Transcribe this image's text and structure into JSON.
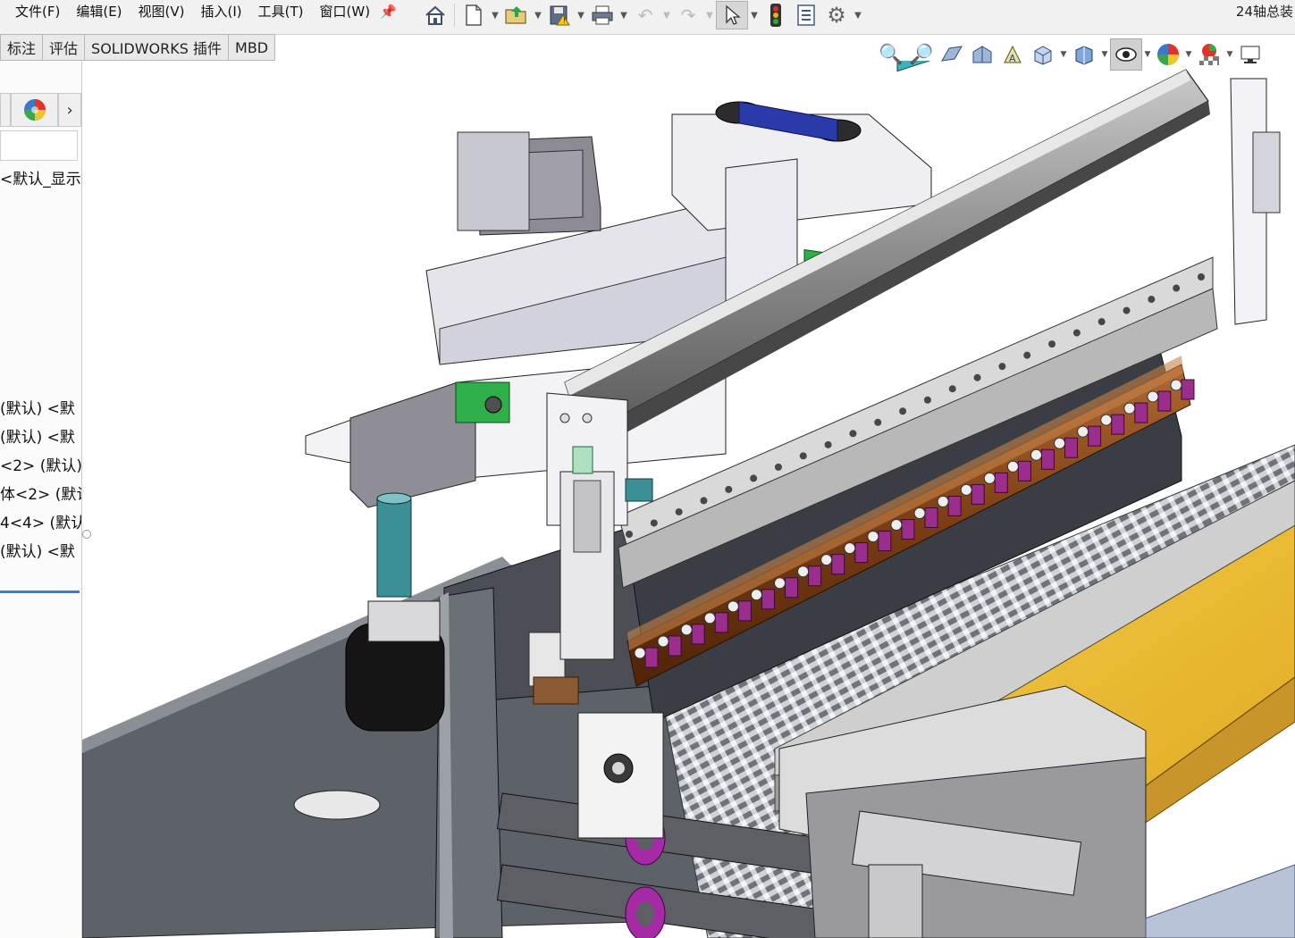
{
  "menu": {
    "items": [
      "文件(F)",
      "编辑(E)",
      "视图(V)",
      "插入(I)",
      "工具(T)",
      "窗口(W)"
    ],
    "pin_icon": "pin-icon"
  },
  "toolbar": {
    "icons": [
      "home-icon",
      "new-document-icon",
      "open-folder-icon",
      "save-icon",
      "print-icon",
      "undo-icon",
      "redo-icon",
      "select-arrow-icon",
      "traffic-light-icon",
      "file-properties-icon",
      "options-gear-icon"
    ]
  },
  "document": {
    "title": "24轴总装"
  },
  "command_tabs": [
    "标注",
    "评估",
    "SOLIDWORKS 插件",
    "MBD"
  ],
  "view_toolbar": {
    "icons": [
      "zoom-to-fit-icon",
      "zoom-to-area-icon",
      "previous-view-icon",
      "section-view-icon",
      "dynamic-annotation-icon",
      "view-orientation-icon",
      "display-style-icon",
      "hide-show-items-icon",
      "edit-appearance-icon",
      "apply-scene-icon",
      "view-settings-icon"
    ]
  },
  "feature_tree": {
    "header": "<默认_显示>",
    "items": [
      "(默认) <默",
      "(默认) <默",
      "<2> (默认)",
      "体<2> (默认",
      "4<4> (默认",
      "(默认) <默"
    ]
  },
  "colors": {
    "accent_blue": "#3b7bd4",
    "part_purple": "#9b2d8c",
    "part_yellow": "#f5c842",
    "part_brown": "#8a4a1e",
    "part_teal": "#3c8f95",
    "part_green": "#2eaf4a",
    "belt_blue": "#2a3aa8"
  }
}
